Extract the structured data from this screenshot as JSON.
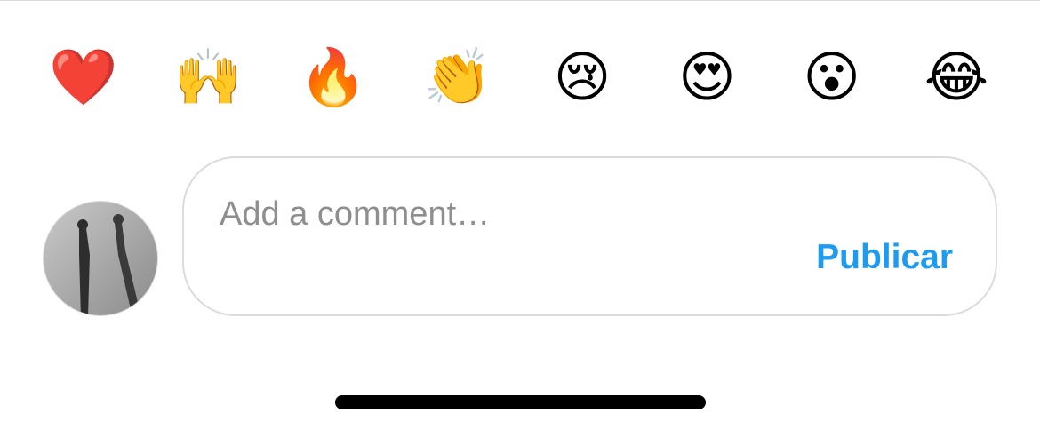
{
  "reactions": [
    {
      "emoji": "❤️",
      "icon": "red-heart-icon"
    },
    {
      "emoji": "🙌",
      "icon": "raising-hands-icon"
    },
    {
      "emoji": "🔥",
      "icon": "fire-icon"
    },
    {
      "emoji": "👏",
      "icon": "clapping-hands-icon"
    },
    {
      "emoji": "😢",
      "icon": "crying-face-icon"
    },
    {
      "emoji": "😍",
      "icon": "heart-eyes-face-icon"
    },
    {
      "emoji": "😮",
      "icon": "surprised-face-icon"
    },
    {
      "emoji": "😂",
      "icon": "tears-of-joy-face-icon"
    }
  ],
  "composer": {
    "value": "",
    "placeholder": "Add a comment…",
    "post_label": "Publicar"
  },
  "colors": {
    "accent": "#1d9bf0",
    "border": "#dbdbdb",
    "text": "#262626"
  }
}
